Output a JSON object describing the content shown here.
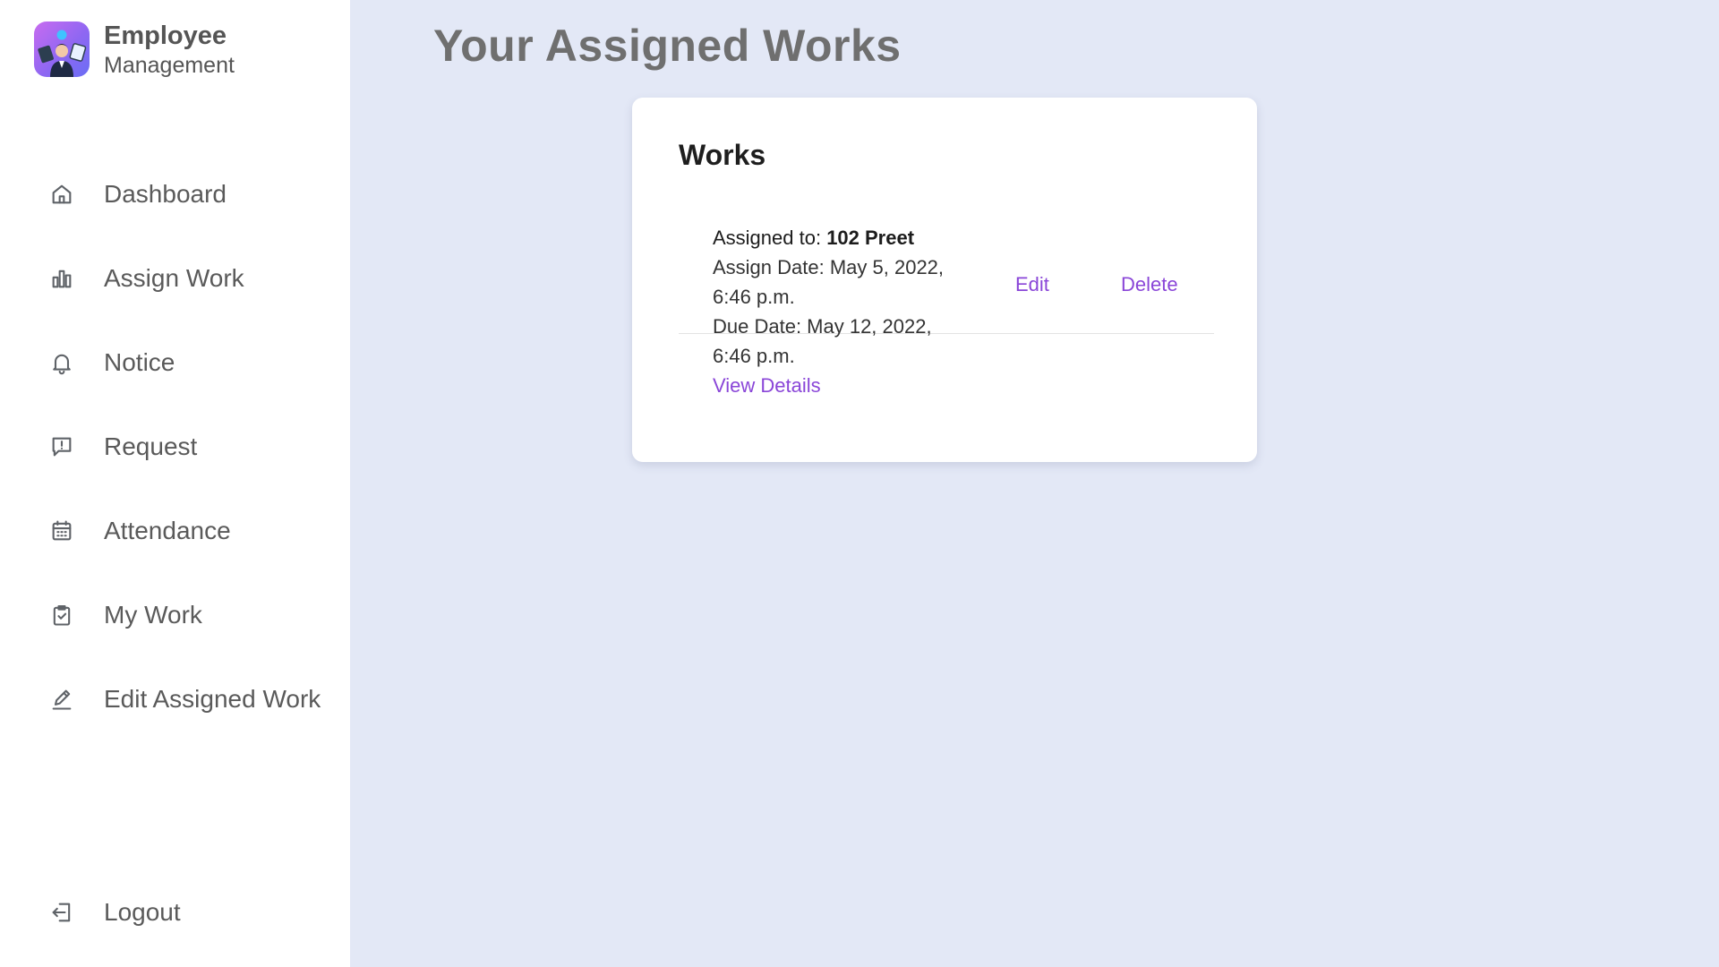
{
  "brand": {
    "title": "Employee",
    "subtitle": "Management"
  },
  "sidebar": {
    "items": [
      {
        "label": "Dashboard",
        "icon": "home-icon"
      },
      {
        "label": "Assign Work",
        "icon": "bar-chart-icon"
      },
      {
        "label": "Notice",
        "icon": "bell-icon"
      },
      {
        "label": "Request",
        "icon": "message-alert-icon"
      },
      {
        "label": "Attendance",
        "icon": "calendar-icon"
      },
      {
        "label": "My Work",
        "icon": "clipboard-check-icon"
      },
      {
        "label": "Edit Assigned Work",
        "icon": "pencil-icon"
      }
    ],
    "logout": {
      "label": "Logout",
      "icon": "logout-icon"
    }
  },
  "main": {
    "title": "Your Assigned Works",
    "card": {
      "title": "Works",
      "works": [
        {
          "assigned_label": "Assigned to:",
          "assigned_to": "102 Preet",
          "assign_date": "Assign Date: May 5, 2022, 6:46 p.m.",
          "due_date": "Due Date: May 12, 2022, 6:46 p.m.",
          "view_details": "View Details",
          "edit": "Edit",
          "delete": "Delete"
        }
      ]
    }
  },
  "colors": {
    "background": "#e3e8f6",
    "sidebar": "#ffffff",
    "link": "#8a46d8",
    "brand_gradient_start": "#c86cf0",
    "brand_gradient_end": "#6a6ef5"
  }
}
